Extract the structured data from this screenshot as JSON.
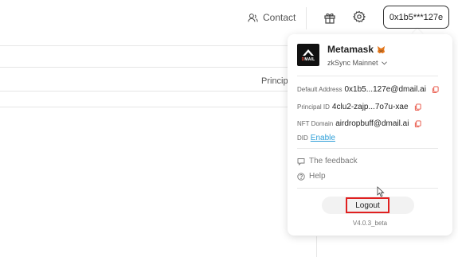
{
  "header": {
    "contact_label": "Contact",
    "wallet_button_label": "0x1b5***127e",
    "icons": [
      "contact-icon",
      "gift-icon",
      "gear-icon"
    ]
  },
  "background": {
    "column_header": "Principa"
  },
  "popup": {
    "logo_text_prefix": "D",
    "logo_text_suffix": "MAIL",
    "wallet_name": "Metamask",
    "network": "zkSync Mainnet",
    "default_address": {
      "label": "Default Address",
      "value": "0x1b5...127e@dmail.ai"
    },
    "principal_id": {
      "label": "Principal ID",
      "value": "4clu2-zajp...7o7u-xae"
    },
    "nft_domain": {
      "label": "NFT Domain",
      "value": "airdropbuff@dmail.ai"
    },
    "did": {
      "label": "DID",
      "action": "Enable"
    },
    "feedback_label": "The feedback",
    "help_label": "Help",
    "logout_label": "Logout",
    "version": "V4.0.3_beta"
  },
  "colors": {
    "accent_link": "#2e9fd8",
    "copy_icon": "#e74c3c",
    "highlight_border": "#e02020"
  }
}
